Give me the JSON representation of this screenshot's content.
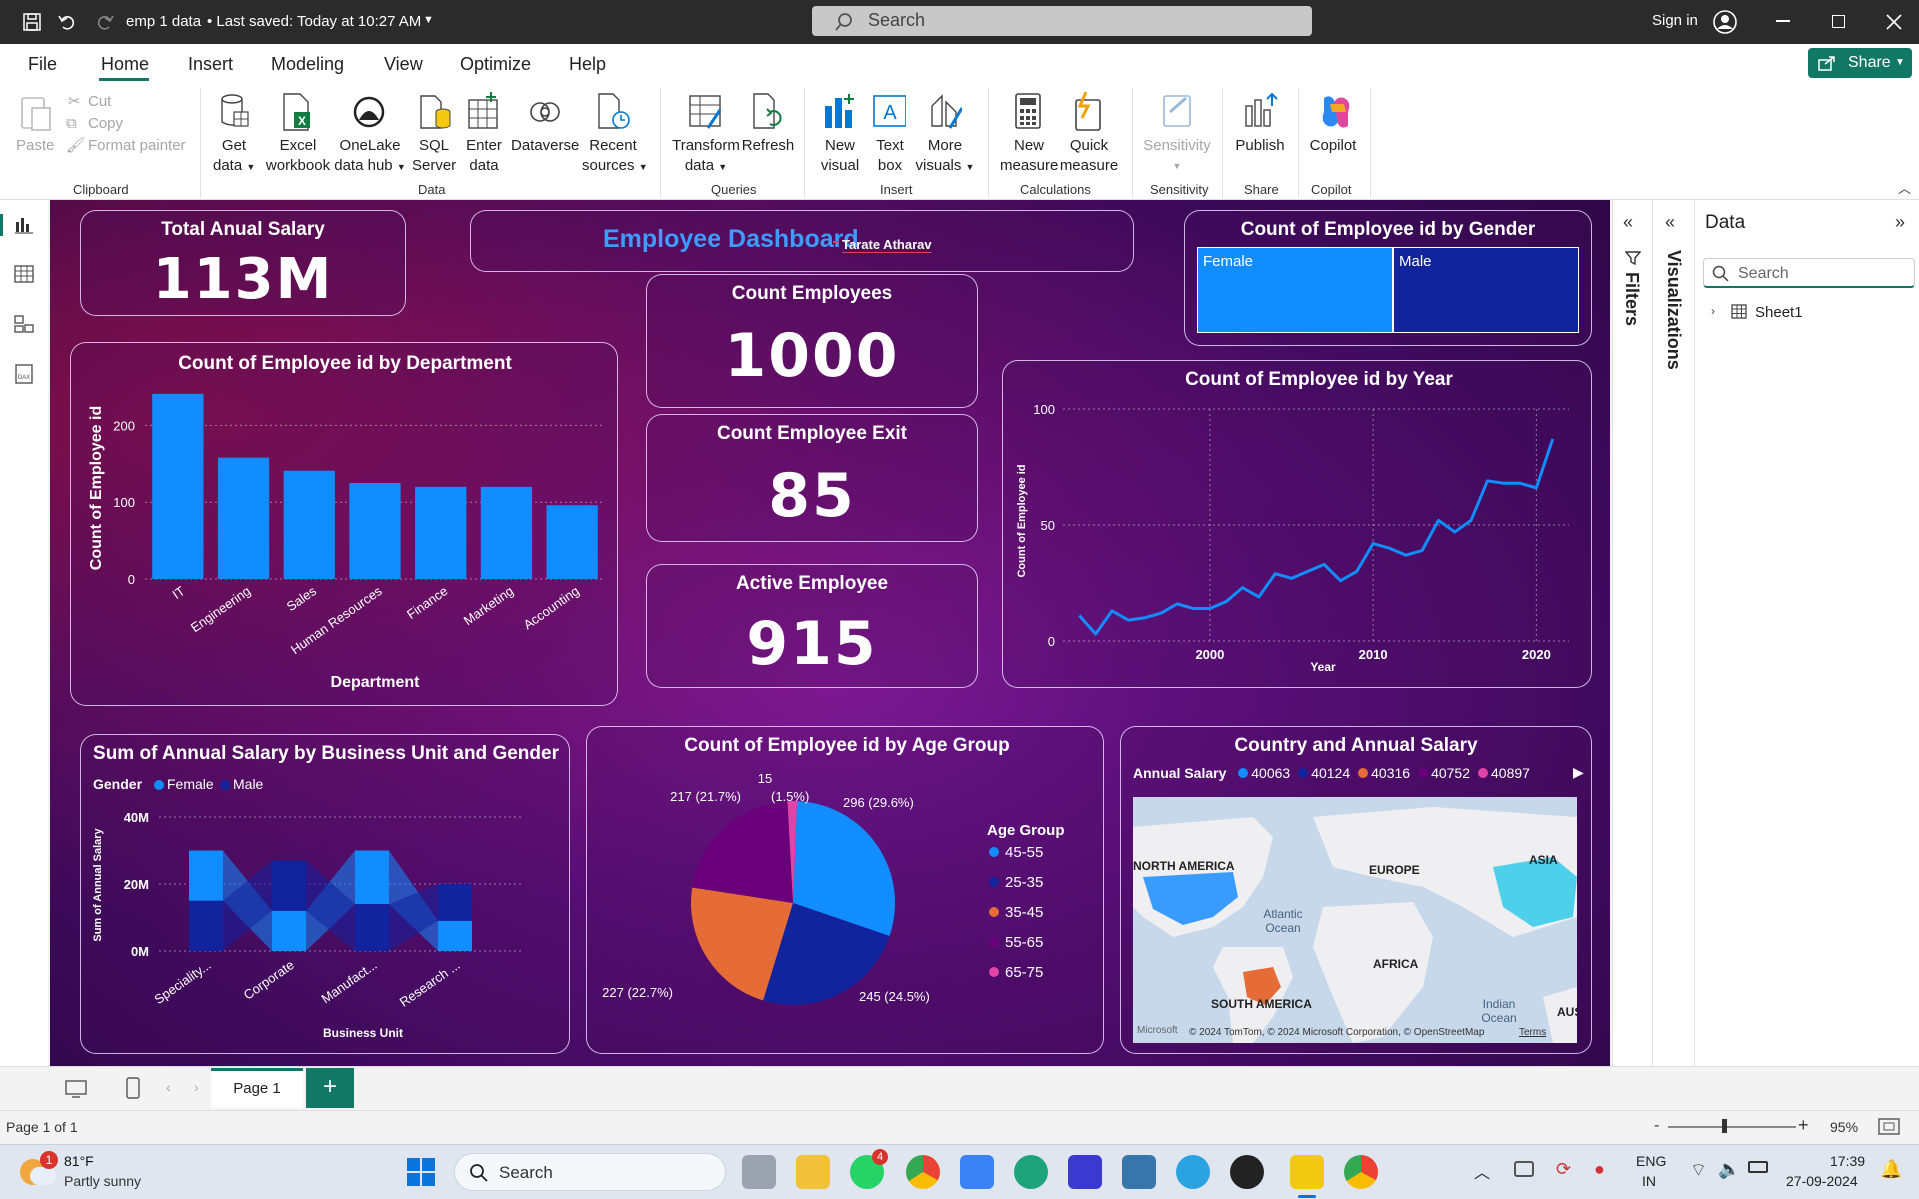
{
  "titlebar": {
    "doc_title": "emp 1 data",
    "saved_status": "• Last saved: Today at 10:27 AM",
    "search_placeholder": "Search",
    "sign_in": "Sign in"
  },
  "menu": {
    "tabs": [
      "File",
      "Home",
      "Insert",
      "Modeling",
      "View",
      "Optimize",
      "Help"
    ],
    "active": "Home",
    "share_label": "Share"
  },
  "ribbon": {
    "clipboard": {
      "paste": "Paste",
      "cut": "Cut",
      "copy": "Copy",
      "format_painter": "Format painter",
      "group": "Clipboard"
    },
    "data": {
      "get_data": [
        "Get",
        "data"
      ],
      "excel": [
        "Excel",
        "workbook"
      ],
      "onelake": [
        "OneLake",
        "data hub"
      ],
      "sql": [
        "SQL",
        "Server"
      ],
      "enter": [
        "Enter",
        "data"
      ],
      "dataverse": [
        "Dataverse"
      ],
      "recent": [
        "Recent",
        "sources"
      ],
      "group": "Data"
    },
    "queries": {
      "transform": [
        "Transform",
        "data"
      ],
      "refresh": "Refresh",
      "group": "Queries"
    },
    "insert": {
      "new_visual": [
        "New",
        "visual"
      ],
      "text_box": [
        "Text",
        "box"
      ],
      "more_visuals": [
        "More",
        "visuals"
      ],
      "group": "Insert"
    },
    "calculations": {
      "new_measure": [
        "New",
        "measure"
      ],
      "quick_measure": [
        "Quick",
        "measure"
      ],
      "group": "Calculations"
    },
    "sensitivity": {
      "label": "Sensitivity",
      "group": "Sensitivity"
    },
    "share": {
      "publish": "Publish",
      "group": "Share"
    },
    "copilot": {
      "label": "Copilot",
      "group": "Copilot"
    }
  },
  "dashboard": {
    "title": "Employee Dashboard",
    "author": "Tarate Atharav",
    "kpis": {
      "total_salary": {
        "label": "Total Anual Salary",
        "value": "113M"
      },
      "count_employees": {
        "label": "Count Employees",
        "value": "1000"
      },
      "count_exit": {
        "label": "Count Employee Exit",
        "value": "85"
      },
      "active": {
        "label": "Active Employee",
        "value": "915"
      }
    }
  },
  "gender_treemap": {
    "title": "Count of Employee id by Gender",
    "labels": [
      "Female",
      "Male"
    ],
    "colors": [
      "#118dff",
      "#12239e"
    ]
  },
  "chart_data": [
    {
      "type": "bar",
      "title": "Count of Employee id by Department",
      "categories": [
        "IT",
        "Engineering",
        "Sales",
        "Human Resources",
        "Finance",
        "Marketing",
        "Accounting"
      ],
      "values": [
        241,
        158,
        141,
        125,
        120,
        120,
        96
      ],
      "xlabel": "Department",
      "ylabel": "Count of Employee id",
      "yticks": [
        "0",
        "100",
        "200"
      ],
      "ylim": [
        0,
        250
      ],
      "color": "#118dff"
    },
    {
      "type": "line",
      "title": "Count of Employee id by Year",
      "x": [
        1992,
        1993,
        1994,
        1995,
        1996,
        1997,
        1998,
        1999,
        2000,
        2001,
        2002,
        2003,
        2004,
        2005,
        2006,
        2007,
        2008,
        2009,
        2010,
        2011,
        2012,
        2013,
        2014,
        2015,
        2016,
        2017,
        2018,
        2019,
        2020,
        2021
      ],
      "values": [
        11,
        3,
        13,
        9,
        10,
        12,
        16,
        14,
        14,
        17,
        23,
        19,
        29,
        27,
        30,
        33,
        26,
        30,
        42,
        40,
        37,
        39,
        52,
        47,
        52,
        69,
        68,
        68,
        66,
        87
      ],
      "xlabel": "Year",
      "ylabel": "Count of Employee id",
      "xticks": [
        "2000",
        "2010",
        "2020"
      ],
      "yticks": [
        "0",
        "50",
        "100"
      ],
      "ylim": [
        0,
        100
      ],
      "color": "#118dff"
    },
    {
      "type": "bar",
      "title": "Sum of Annual Salary by Business Unit and Gender",
      "legend_title": "Gender",
      "categories": [
        "Speciality...",
        "Corporate",
        "Manufact...",
        "Research ..."
      ],
      "series": [
        {
          "name": "Female",
          "values": [
            15,
            12,
            16,
            9
          ],
          "color": "#118dff"
        },
        {
          "name": "Male",
          "values": [
            15,
            15,
            14,
            11
          ],
          "color": "#12239e"
        }
      ],
      "xlabel": "Business Unit",
      "ylabel": "Sum of Annual Salary",
      "yticks": [
        "0M",
        "20M",
        "40M"
      ],
      "ylim": [
        0,
        40
      ]
    },
    {
      "type": "pie",
      "title": "Count of Employee id by Age Group",
      "legend_title": "Age Group",
      "labels": [
        "45-55",
        "25-35",
        "35-45",
        "55-65",
        "65-75"
      ],
      "values": [
        296,
        245,
        227,
        217,
        15
      ],
      "data_labels": [
        "296 (29.6%)",
        "245 (24.5%)",
        "227 (22.7%)",
        "217 (21.7%)",
        "15"
      ],
      "extra_label": "(1.5%)",
      "colors": [
        "#118dff",
        "#12239e",
        "#e66c37",
        "#6b007b",
        "#e044a7"
      ]
    }
  ],
  "map": {
    "title": "Country and Annual Salary",
    "legend_title": "Annual Salary",
    "legend_items": [
      {
        "label": "40063",
        "color": "#118dff"
      },
      {
        "label": "40124",
        "color": "#12239e"
      },
      {
        "label": "40316",
        "color": "#e66c37"
      },
      {
        "label": "40752",
        "color": "#6b007b"
      },
      {
        "label": "40897",
        "color": "#e044a7"
      }
    ],
    "regions": [
      "NORTH AMERICA",
      "EUROPE",
      "ASIA",
      "Atlantic Ocean",
      "AFRICA",
      "SOUTH AMERICA",
      "Indian Ocean",
      "AUS"
    ],
    "copyright": "© 2024 TomTom, © 2024 Microsoft Corporation, © OpenStreetMap",
    "terms": "Terms",
    "brand": "Microsoft"
  },
  "panes": {
    "filters": "Filters",
    "visualizations": "Visualizations",
    "data_title": "Data",
    "data_search": "Search",
    "table": "Sheet1"
  },
  "pages": {
    "tab": "Page 1",
    "status": "Page 1 of 1",
    "zoom": "95%"
  },
  "taskbar": {
    "temp": "81°F",
    "weather": "Partly sunny",
    "search": "Search",
    "lang1": "ENG",
    "lang2": "IN",
    "time": "17:39",
    "date": "27-09-2024",
    "badge_weather": "1",
    "badge_whatsapp": "4"
  }
}
